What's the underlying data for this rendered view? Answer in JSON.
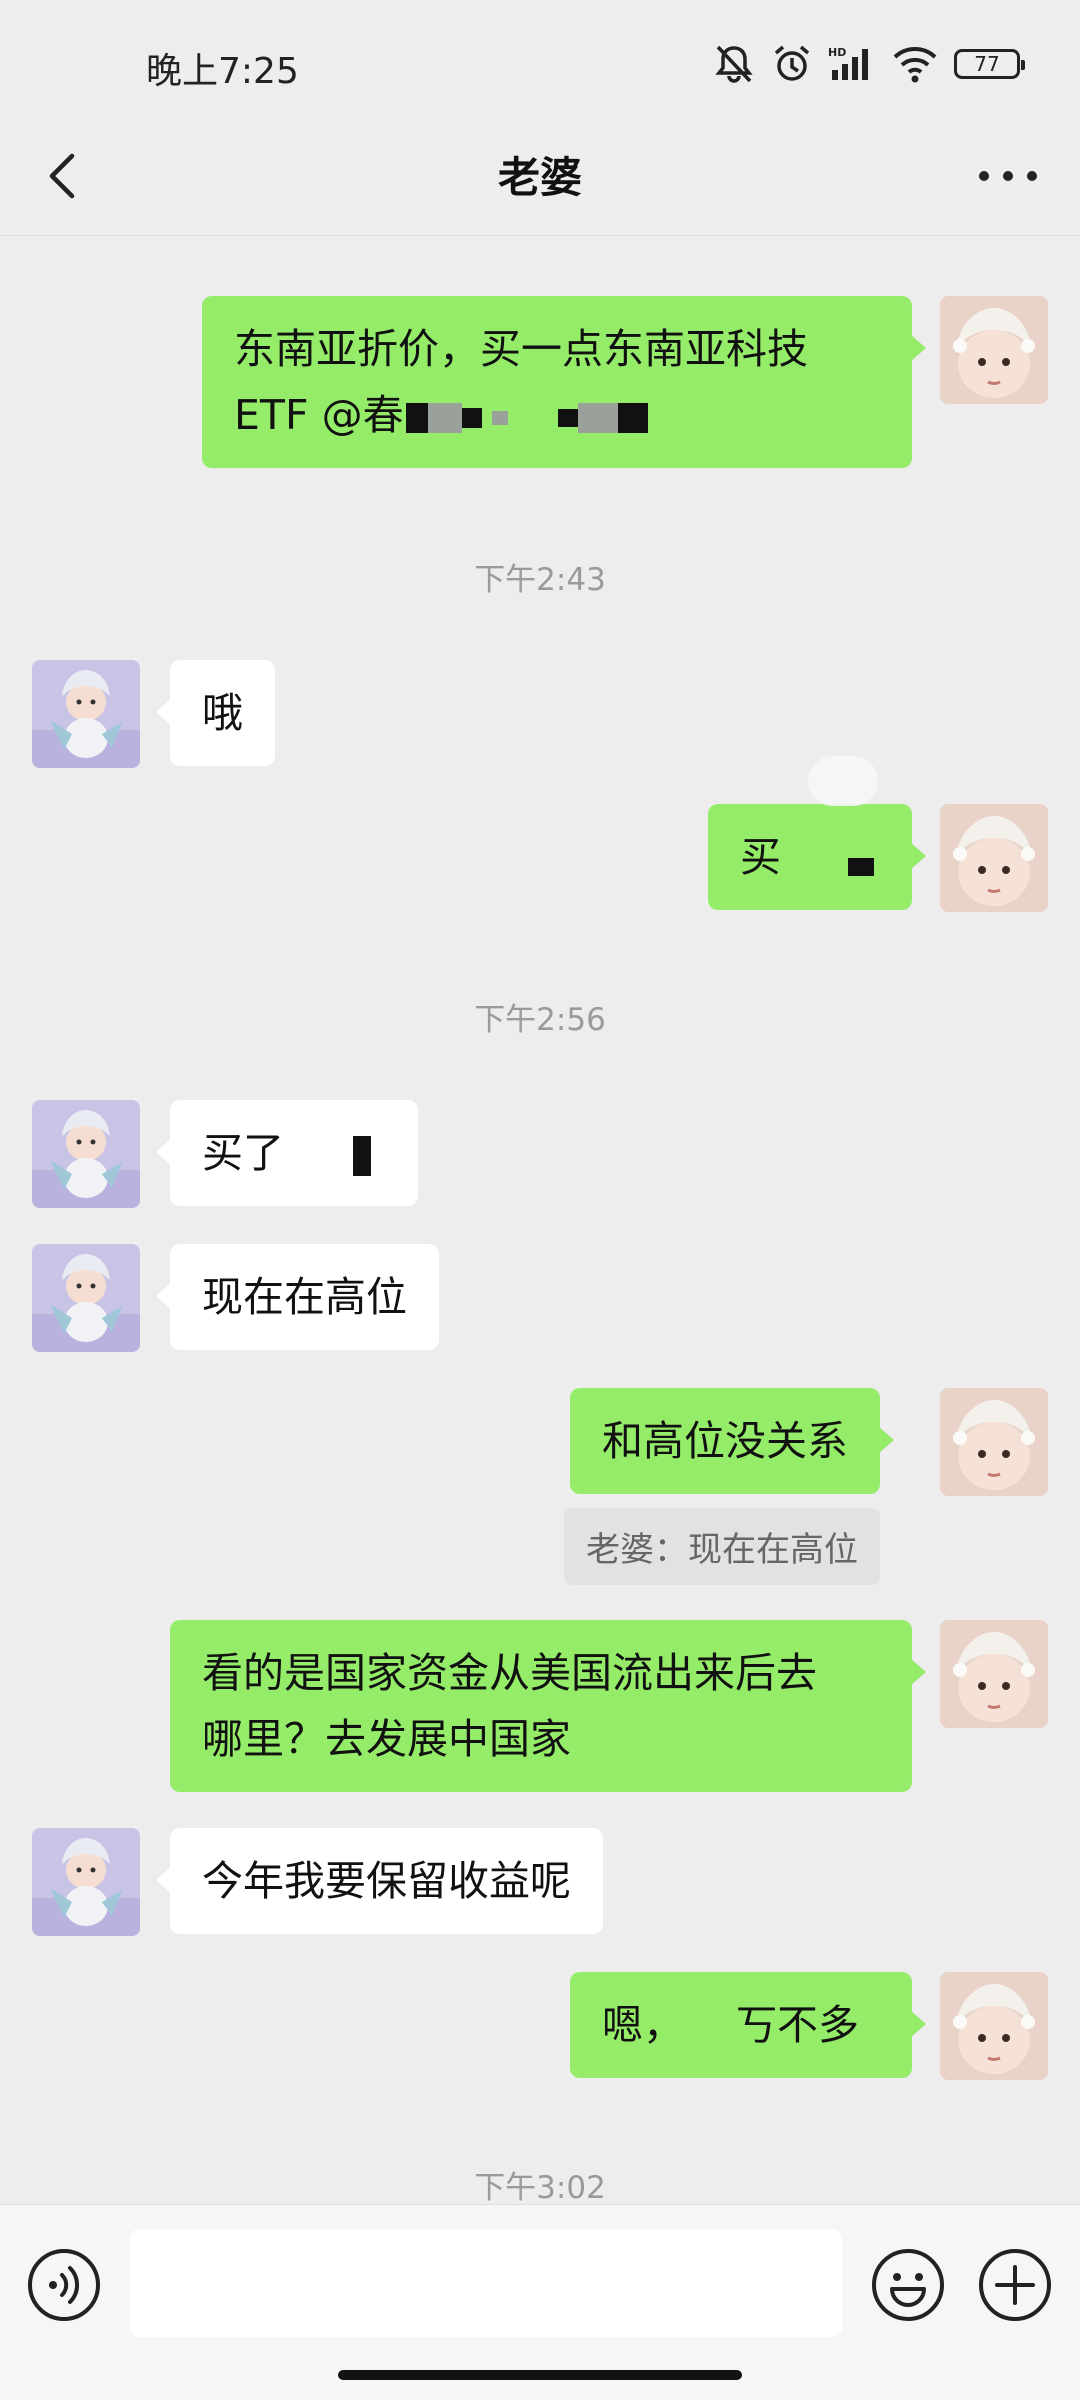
{
  "status_bar": {
    "time": "晚上7:25",
    "battery": "77",
    "icons": [
      "mute-icon",
      "alarm-icon",
      "hd-signal-icon",
      "wifi-icon",
      "battery-icon"
    ]
  },
  "nav": {
    "title": "老婆",
    "back_icon": "chevron-left-icon",
    "more_icon": "more-icon"
  },
  "messages": [
    {
      "side": "me",
      "lines": [
        "东南亚折价，买一点东南亚科技",
        "ETF @春"
      ],
      "redacted": true
    },
    {
      "type": "time",
      "text": "下午2:43"
    },
    {
      "side": "them",
      "text": "哦"
    },
    {
      "side": "me",
      "text": "买",
      "redacted": true
    },
    {
      "type": "time",
      "text": "下午2:56"
    },
    {
      "side": "them",
      "text": "买了",
      "redacted": true
    },
    {
      "side": "them",
      "text": "现在在高位"
    },
    {
      "side": "me",
      "text": "和高位没关系",
      "quote": "老婆：现在在高位"
    },
    {
      "side": "me",
      "lines": [
        "看的是国家资金从美国流出来后去",
        "哪里？去发展中国家"
      ]
    },
    {
      "side": "them",
      "text": "今年我要保留收益呢"
    },
    {
      "side": "me",
      "text_start": "嗯，",
      "text_end": "丂不多",
      "redacted": true
    },
    {
      "type": "time",
      "text": "下午3:02"
    }
  ],
  "input_bar": {
    "voice_icon": "voice-icon",
    "emoji_icon": "emoji-icon",
    "plus_icon": "plus-icon",
    "value": ""
  },
  "colors": {
    "background": "#ededed",
    "my_bubble": "#95ec69",
    "their_bubble": "#ffffff",
    "timestamp": "#9a9a9a"
  }
}
